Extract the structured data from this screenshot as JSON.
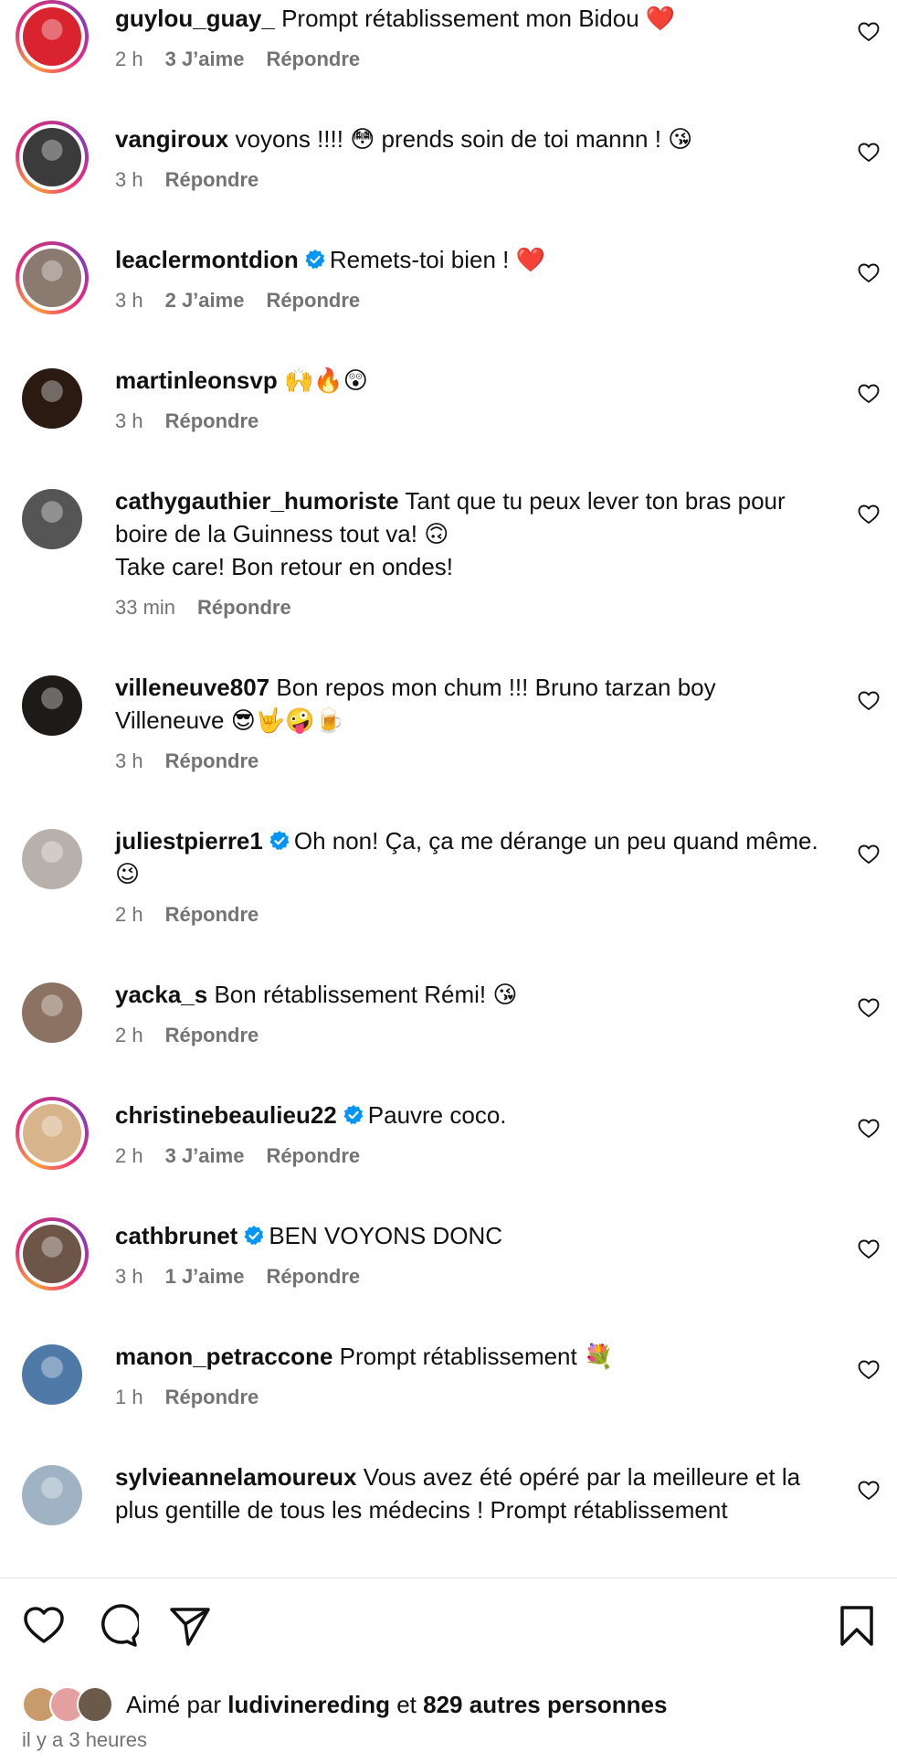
{
  "comments": [
    {
      "username": "guylou_guay_",
      "verified": false,
      "text": "Prompt rétablissement mon Bidou ❤️",
      "time": "2 h",
      "likes": "3 J’aime",
      "reply": "Répondre",
      "ring": true,
      "avatar_color": "#d9232e"
    },
    {
      "username": "vangiroux",
      "verified": false,
      "text": "voyons !!!! 😳 prends soin de toi mannn ! 😘",
      "time": "3 h",
      "likes": "",
      "reply": "Répondre",
      "ring": true,
      "avatar_color": "#3b3b3b"
    },
    {
      "username": "leaclermontdion",
      "verified": true,
      "text": "Remets-toi bien ! ❤️",
      "time": "3 h",
      "likes": "2 J’aime",
      "reply": "Répondre",
      "ring": true,
      "avatar_color": "#8a7a70"
    },
    {
      "username": "martinleonsvp",
      "verified": false,
      "text": "🙌🔥😲",
      "time": "3 h",
      "likes": "",
      "reply": "Répondre",
      "ring": false,
      "avatar_color": "#2a1a12"
    },
    {
      "username": "cathygauthier_humoriste",
      "verified": false,
      "text": "Tant que tu peux lever ton bras pour boire de la Guinness tout va! 🙃\nTake care! Bon retour en ondes!",
      "time": "33 min",
      "likes": "",
      "reply": "Répondre",
      "ring": false,
      "avatar_color": "#555555"
    },
    {
      "username": "villeneuve807",
      "verified": false,
      "text": "Bon repos mon chum !!! Bruno tarzan boy Villeneuve 😎🤟🤪🍺",
      "time": "3 h",
      "likes": "",
      "reply": "Répondre",
      "ring": false,
      "avatar_color": "#1e1a18"
    },
    {
      "username": "juliestpierre1",
      "verified": true,
      "text": "Oh non! Ça, ça me dérange un peu quand même. 😉",
      "time": "2 h",
      "likes": "",
      "reply": "Répondre",
      "ring": false,
      "avatar_color": "#b8b0aa"
    },
    {
      "username": "yacka_s",
      "verified": false,
      "text": "Bon rétablissement Rémi! 😘",
      "time": "2 h",
      "likes": "",
      "reply": "Répondre",
      "ring": false,
      "avatar_color": "#8c7262"
    },
    {
      "username": "christinebeaulieu22",
      "verified": true,
      "text": "Pauvre coco.",
      "time": "2 h",
      "likes": "3 J’aime",
      "reply": "Répondre",
      "ring": true,
      "avatar_color": "#d8b48c"
    },
    {
      "username": "cathbrunet",
      "verified": true,
      "text": "BEN VOYONS DONC",
      "time": "3 h",
      "likes": "1 J’aime",
      "reply": "Répondre",
      "ring": true,
      "avatar_color": "#6d5548"
    },
    {
      "username": "manon_petraccone",
      "verified": false,
      "text": "Prompt rétablissement 💐",
      "time": "1 h",
      "likes": "",
      "reply": "Répondre",
      "ring": false,
      "avatar_color": "#4f7aa8"
    },
    {
      "username": "sylvieannelamoureux",
      "verified": false,
      "text": "Vous avez été opéré par la meilleure et la plus gentille de tous les médecins ! Prompt rétablissement",
      "time": "",
      "likes": "",
      "reply": "",
      "ring": false,
      "avatar_color": "#9fb3c4"
    }
  ],
  "footer": {
    "liked_prefix": "Aimé par",
    "liked_user": "ludivinereding",
    "liked_and": "et",
    "liked_others": "829 autres personnes",
    "time_ago": "il y a 3 heures",
    "mini_avatar_colors": [
      "#c99a6a",
      "#e4a0a0",
      "#6b5a4a"
    ]
  },
  "icons": {
    "like": "heart-icon",
    "comment": "comment-icon",
    "share": "send-icon",
    "save": "bookmark-icon",
    "verified": "verified-badge-icon"
  },
  "colors": {
    "secondary_text": "#737373",
    "verified_blue": "#0095f6"
  }
}
